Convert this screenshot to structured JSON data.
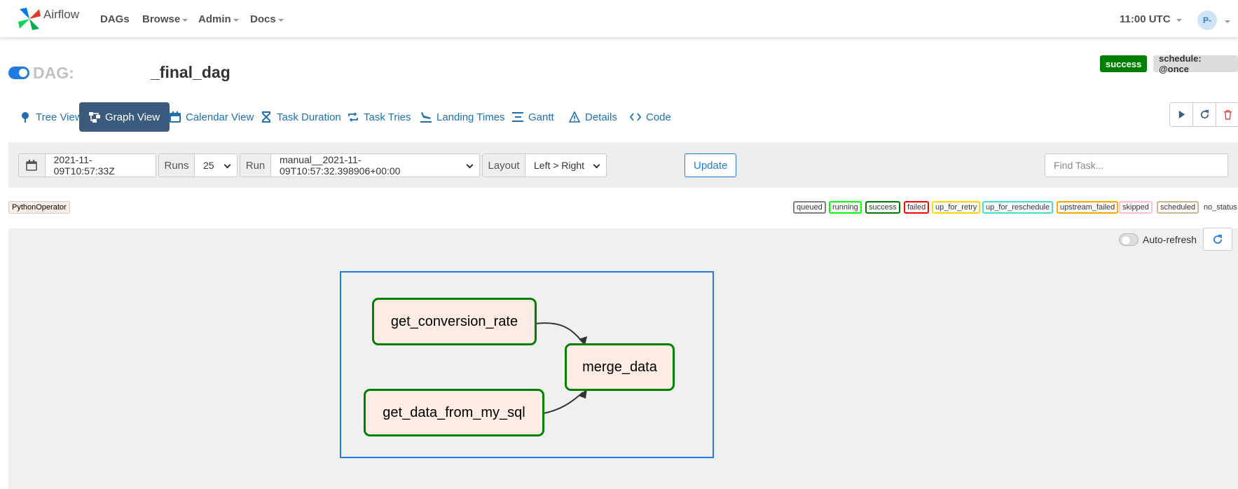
{
  "navbar": {
    "brand": "Airflow",
    "menu": [
      {
        "label": "DAGs",
        "has_caret": false
      },
      {
        "label": "Browse",
        "has_caret": true
      },
      {
        "label": "Admin",
        "has_caret": true
      },
      {
        "label": "Docs",
        "has_caret": true
      }
    ],
    "clock": "11:00 UTC",
    "user_initials": "P-"
  },
  "dag": {
    "label": "DAG:",
    "name": "_final_dag",
    "state_badge": "success",
    "schedule_badge": "schedule: @once",
    "paused": false
  },
  "tabs": [
    {
      "label": "Tree View",
      "icon": "tree-icon",
      "active": false
    },
    {
      "label": "Graph View",
      "icon": "graph-icon",
      "active": true
    },
    {
      "label": "Calendar View",
      "icon": "calendar-icon",
      "active": false
    },
    {
      "label": "Task Duration",
      "icon": "hourglass-icon",
      "active": false
    },
    {
      "label": "Task Tries",
      "icon": "retry-icon",
      "active": false
    },
    {
      "label": "Landing Times",
      "icon": "landing-icon",
      "active": false
    },
    {
      "label": "Gantt",
      "icon": "gantt-icon",
      "active": false
    },
    {
      "label": "Details",
      "icon": "warning-icon",
      "active": false
    },
    {
      "label": "Code",
      "icon": "code-icon",
      "active": false
    }
  ],
  "actions": [
    {
      "name": "trigger-dag-button",
      "icon": "play-icon"
    },
    {
      "name": "refresh-dag-button",
      "icon": "refresh-icon"
    },
    {
      "name": "delete-dag-button",
      "icon": "trash-icon"
    }
  ],
  "filters": {
    "base_date": "2021-11-09T10:57:33Z",
    "runs_label": "Runs",
    "runs_value": "25",
    "run_label": "Run",
    "run_value": "manual__2021-11-09T10:57:32.398906+00:00",
    "layout_label": "Layout",
    "layout_value": "Left > Right",
    "update_label": "Update",
    "find_task_placeholder": "Find Task..."
  },
  "operator_legend": "PythonOperator",
  "state_legend": [
    {
      "label": "queued",
      "color": "#808080"
    },
    {
      "label": "running",
      "color": "#00ff00"
    },
    {
      "label": "success",
      "color": "#008000"
    },
    {
      "label": "failed",
      "color": "#ff0000"
    },
    {
      "label": "up_for_retry",
      "color": "#ffd700"
    },
    {
      "label": "up_for_reschedule",
      "color": "#40e0d0"
    },
    {
      "label": "upstream_failed",
      "color": "#ffa500"
    },
    {
      "label": "skipped",
      "color": "#ffc0cb"
    },
    {
      "label": "scheduled",
      "color": "#d2b48c"
    },
    {
      "label": "no_status",
      "color": null
    }
  ],
  "graph": {
    "auto_refresh_label": "Auto-refresh",
    "auto_refresh_on": false,
    "tasks": {
      "get_conversion_rate": "get_conversion_rate",
      "get_data_from_my_sql": "get_data_from_my_sql",
      "merge_data": "merge_data"
    },
    "edges": [
      {
        "from": "get_conversion_rate",
        "to": "merge_data"
      },
      {
        "from": "get_data_from_my_sql",
        "to": "merge_data"
      }
    ],
    "colors": {
      "success_border": "#008000",
      "task_fill": "#fdece4",
      "group_border": "#1e7ce0"
    }
  }
}
